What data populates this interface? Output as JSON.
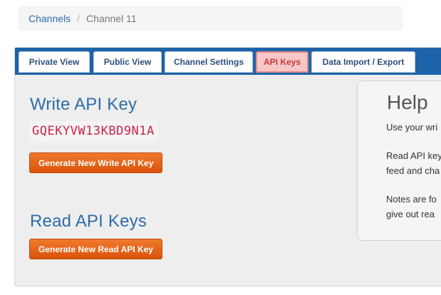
{
  "breadcrumb": {
    "channels_label": "Channels",
    "separator": "/",
    "current_label": "Channel 11"
  },
  "tabs": [
    {
      "label": "Private View",
      "active": false
    },
    {
      "label": "Public View",
      "active": false
    },
    {
      "label": "Channel Settings",
      "active": false
    },
    {
      "label": "API Keys",
      "active": true
    },
    {
      "label": "Data Import / Export",
      "active": false
    }
  ],
  "write_section": {
    "title": "Write API Key",
    "key": "GQEKYVW13KBD9N1A",
    "button_label": "Generate New Write API Key"
  },
  "read_section": {
    "title": "Read API Keys",
    "button_label": "Generate New Read API Key"
  },
  "help": {
    "title": "Help",
    "line1": "Use your wri",
    "line2": "Read API key",
    "line3": "feed and cha",
    "line4": "Notes are fo",
    "line5": "give out rea"
  },
  "colors": {
    "tabbar": "#1c63a9",
    "active_tab_bg": "#f7c6c6",
    "title_blue": "#2f6ca8",
    "key_red": "#c7254e",
    "button_orange": "#e0621a"
  }
}
